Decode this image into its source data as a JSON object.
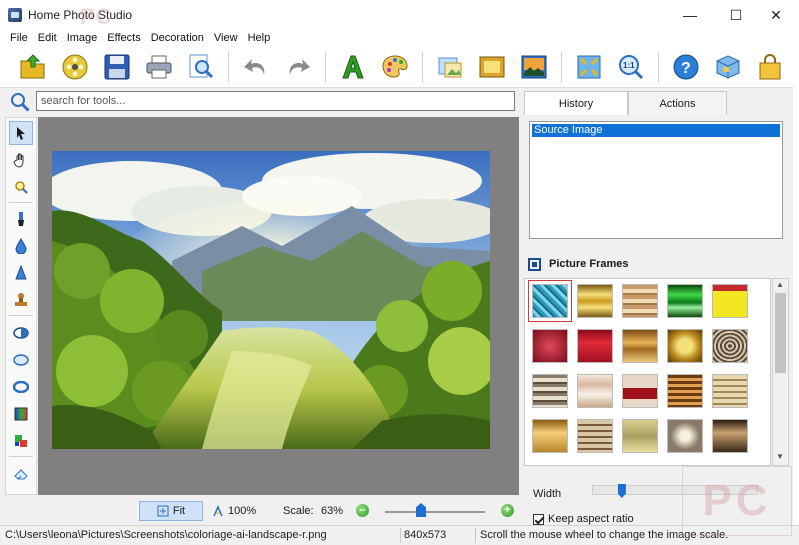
{
  "window": {
    "title": "Home Photo Studio",
    "watermark_small": "PC",
    "watermark_big": "PC",
    "minimize": "—",
    "maximize": "☐",
    "close": "✕"
  },
  "menu": [
    "File",
    "Edit",
    "Image",
    "Effects",
    "Decoration",
    "View",
    "Help"
  ],
  "toolbar": {
    "icons": [
      "open-folder-icon",
      "film-reel-icon",
      "save-disk-icon",
      "printer-icon",
      "zoom-preview-icon",
      "undo-arrow-icon",
      "redo-arrow-icon",
      "text-a-icon",
      "palette-icon",
      "image-adjust-icon",
      "picture-frame-icon",
      "landscape-icon",
      "fit-window-icon",
      "actual-size-icon",
      "help-icon",
      "package-icon",
      "shopping-bag-icon"
    ]
  },
  "search": {
    "placeholder": "search for tools..."
  },
  "tools": [
    "arrow-pointer-icon",
    "hand-pan-icon",
    "magnifier-tool-icon",
    "brush-icon",
    "drop-blur-icon",
    "sharpen-cone-icon",
    "stamp-icon",
    "eraser-half-icon",
    "ellipse-select-icon",
    "ring-select-icon",
    "gradient-fill-icon",
    "color-swap-icon",
    "eraser-icon"
  ],
  "canvas_bar": {
    "fit_label": "Fit",
    "zoom100_label": "100%",
    "scale_label": "Scale:",
    "scale_value": "63%",
    "zoom_out": "–",
    "zoom_in": "+",
    "scale_position": 0.36
  },
  "status": {
    "path": "C:\\Users\\leona\\Pictures\\Screenshots\\coloriage-ai-landscape-r.png",
    "dimensions": "840x573",
    "hint": "Scroll the mouse wheel to change the image scale."
  },
  "right_panel": {
    "tabs": [
      "History",
      "Actions"
    ],
    "history_items": [
      "Source Image"
    ],
    "frames_title": "Picture Frames",
    "width_label": "Width",
    "width_position": 0.18,
    "keep_aspect_label": "Keep aspect ratio",
    "keep_aspect_checked": true
  },
  "colors": {
    "selection": "#0f72d6",
    "accent": "#1d6fd1"
  }
}
